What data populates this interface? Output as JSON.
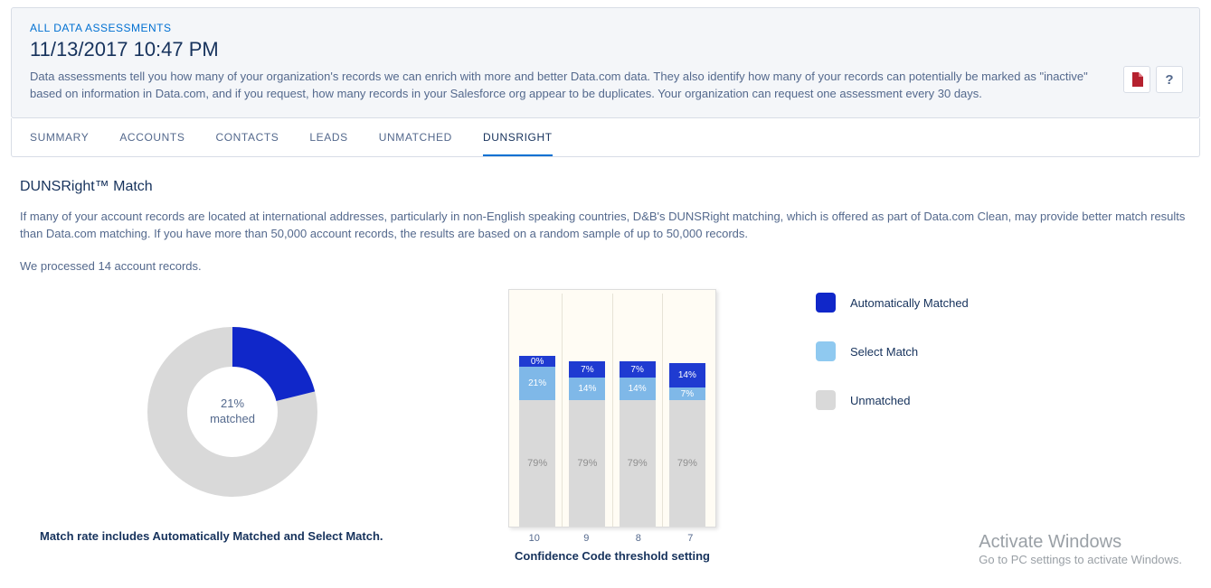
{
  "header": {
    "breadcrumb": "ALL DATA ASSESSMENTS",
    "title": "11/13/2017 10:47 PM",
    "description": "Data assessments tell you how many of your organization's records we can enrich with more and better Data.com data. They also identify how many of your records can potentially be marked as \"inactive\" based on information in Data.com, and if you request, how many records in your Salesforce org appear to be duplicates. Your organization can request one assessment every 30 days.",
    "help_symbol": "?"
  },
  "tabs": {
    "items": [
      {
        "label": "SUMMARY"
      },
      {
        "label": "ACCOUNTS"
      },
      {
        "label": "CONTACTS"
      },
      {
        "label": "LEADS"
      },
      {
        "label": "UNMATCHED"
      },
      {
        "label": "DUNSRIGHT"
      }
    ],
    "active_index": 5
  },
  "section": {
    "title": "DUNSRight™ Match",
    "description": "If many of your account records are located at international addresses, particularly in non-English speaking countries, D&B's DUNSRight matching, which is offered as part of Data.com Clean, may provide better match results than Data.com matching. If you have more than 50,000 account records, the results are based on a random sample of up to 50,000 records.",
    "processed": "We processed 14 account records."
  },
  "donut": {
    "center_line1": "21%",
    "center_line2": "matched",
    "caption": "Match rate includes Automatically Matched and Select Match.",
    "matched_percent": 21
  },
  "legend": {
    "auto": "Automatically Matched",
    "select": "Select Match",
    "unmatched": "Unmatched"
  },
  "watermark": {
    "line1": "Activate Windows",
    "line2": "Go to PC settings to activate Windows."
  },
  "chart_data": {
    "type": "bar",
    "title": "Confidence Code threshold setting",
    "categories": [
      "10",
      "9",
      "8",
      "7"
    ],
    "series": [
      {
        "name": "Unmatched",
        "values": [
          79,
          79,
          79,
          79
        ],
        "color": "#d9d9d9"
      },
      {
        "name": "Select Match",
        "values": [
          21,
          14,
          14,
          7
        ],
        "color": "#7fb8e8"
      },
      {
        "name": "Automatically Matched",
        "values": [
          0,
          7,
          7,
          14
        ],
        "color": "#1f3bd1"
      }
    ],
    "ylim": [
      0,
      100
    ],
    "stacked": true,
    "labels": [
      {
        "unmatched": "79%",
        "select": "21%",
        "auto": "0%"
      },
      {
        "unmatched": "79%",
        "select": "14%",
        "auto": "7%"
      },
      {
        "unmatched": "79%",
        "select": "14%",
        "auto": "7%"
      },
      {
        "unmatched": "79%",
        "select": "7%",
        "auto": "14%"
      }
    ]
  }
}
